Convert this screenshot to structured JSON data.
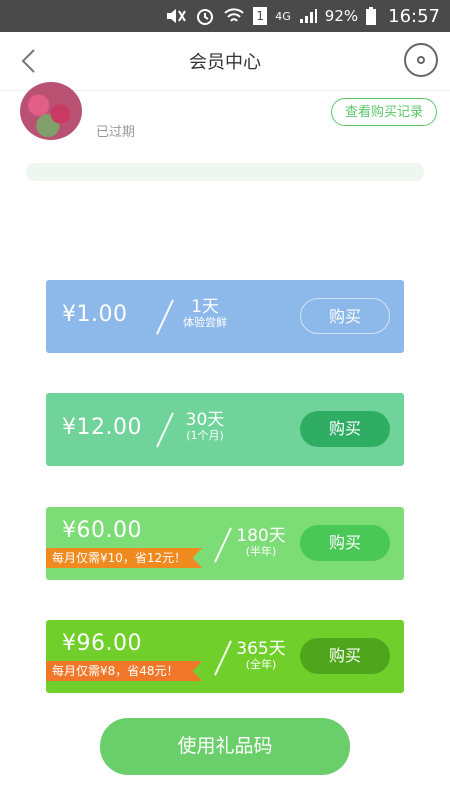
{
  "statusbar": {
    "network": "4G",
    "sim_slot": "1",
    "battery": "92%",
    "time": "16:57"
  },
  "header": {
    "title": "会员中心",
    "back_icon": "chevron-left-icon",
    "disc_icon": "disc-icon"
  },
  "profile": {
    "status": "已过期",
    "history_button": "查看购买记录"
  },
  "plans": [
    {
      "price": "¥1.00",
      "duration": "1天",
      "duration_note": "体验尝鲜",
      "buy_label": "购买",
      "color": "#8cb9ea"
    },
    {
      "price": "¥12.00",
      "duration": "30天",
      "duration_note": "(1个月)",
      "buy_label": "购买",
      "color": "#6fd39a"
    },
    {
      "price": "¥60.00",
      "promo": "每月仅需¥10，省12元！",
      "duration": "180天",
      "duration_note": "(半年)",
      "buy_label": "购买",
      "color": "#7cdc76"
    },
    {
      "price": "¥96.00",
      "promo": "每月仅需¥8，省48元！",
      "duration": "365天",
      "duration_note": "(全年)",
      "buy_label": "购买",
      "color": "#71cf2b"
    }
  ],
  "footer": {
    "gift_button": "使用礼品码"
  },
  "colors": {
    "accent_green": "#5cc66b",
    "statusbar": "#4a4a4a",
    "promo_orange": "#f08a1e"
  }
}
